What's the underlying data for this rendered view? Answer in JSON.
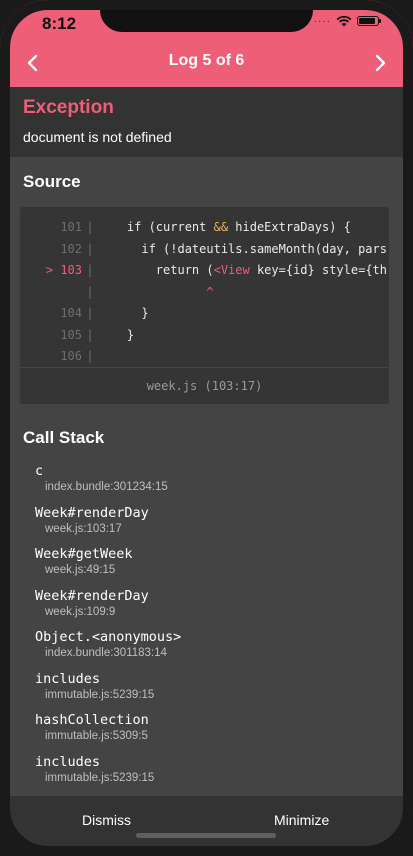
{
  "status": {
    "time": "8:12"
  },
  "nav": {
    "title": "Log 5 of 6"
  },
  "exception": {
    "title": "Exception",
    "message": "document is not defined"
  },
  "source": {
    "title": "Source",
    "lines": [
      {
        "num": "101",
        "code": "    if (current && hideExtraDays) {"
      },
      {
        "num": "102",
        "code": "      if (!dateutils.sameMonth(day, pars"
      },
      {
        "num": "103",
        "code": "        return (<View key={id} style={th"
      },
      {
        "num": "",
        "code": "               ^"
      },
      {
        "num": "104",
        "code": "      }"
      },
      {
        "num": "105",
        "code": "    }"
      },
      {
        "num": "106",
        "code": ""
      }
    ],
    "active_marker": ">",
    "file_ref": "week.js (103:17)"
  },
  "call_stack": {
    "title": "Call Stack",
    "frames": [
      {
        "fn": "c",
        "loc": "index.bundle:301234:15"
      },
      {
        "fn": "Week#renderDay",
        "loc": "week.js:103:17"
      },
      {
        "fn": "Week#getWeek",
        "loc": "week.js:49:15"
      },
      {
        "fn": "Week#renderDay",
        "loc": "week.js:109:9"
      },
      {
        "fn": "Object.<anonymous>",
        "loc": "index.bundle:301183:14"
      },
      {
        "fn": "includes",
        "loc": "immutable.js:5239:15"
      },
      {
        "fn": "hashCollection",
        "loc": "immutable.js:5309:5"
      },
      {
        "fn": "includes",
        "loc": "immutable.js:5239:15"
      }
    ]
  },
  "actions": {
    "dismiss": "Dismiss",
    "minimize": "Minimize"
  },
  "colors": {
    "accent": "#ee5e76",
    "keyword": "#f0b14f",
    "background": "#444444",
    "panel": "#333333"
  }
}
